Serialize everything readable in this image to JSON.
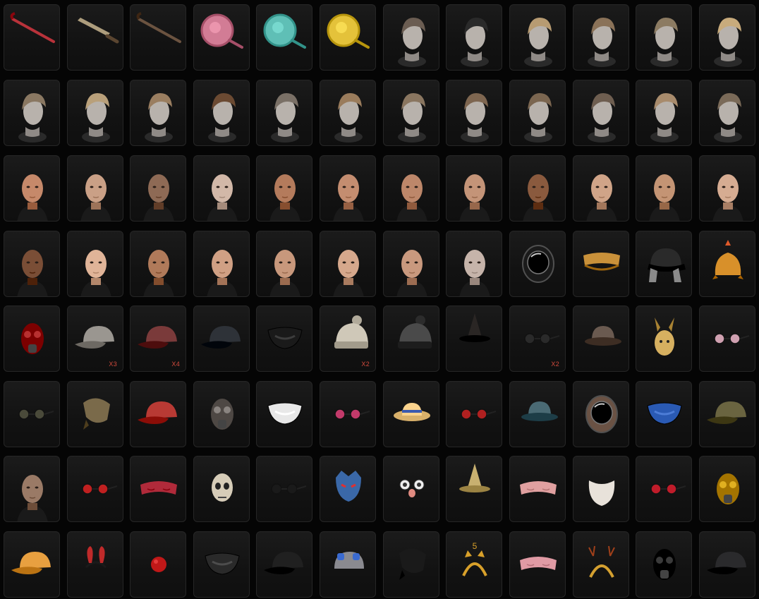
{
  "inventory": {
    "rows": [
      {
        "items": [
          {
            "name": "striped-crowbar-icon",
            "type": "crowbar",
            "color": "#b8323a"
          },
          {
            "name": "machete-icon",
            "type": "machete",
            "color": "#8a7a5a"
          },
          {
            "name": "crowbar-icon",
            "type": "crowbar",
            "color": "#6b5340"
          },
          {
            "name": "pink-frying-pan-icon",
            "type": "pan",
            "color": "#d27c95"
          },
          {
            "name": "graffiti-frying-pan-icon",
            "type": "pan",
            "color": "#5fbfb6"
          },
          {
            "name": "lollipop-frying-pan-icon",
            "type": "pan",
            "color": "#e4c23a"
          },
          {
            "name": "undercut-hair-icon",
            "type": "hair",
            "color": "#6b5d52"
          },
          {
            "name": "black-long-hair-icon",
            "type": "hair",
            "color": "#2a2a2a"
          },
          {
            "name": "blonde-bun-hair-icon",
            "type": "hair",
            "color": "#b79b72"
          },
          {
            "name": "tied-hair-icon",
            "type": "hair",
            "color": "#8a7258"
          },
          {
            "name": "dreadlocks-hair-icon",
            "type": "hair",
            "color": "#8c7b62"
          },
          {
            "name": "blonde-bob-hair-icon",
            "type": "hair",
            "color": "#c8ab7c"
          }
        ]
      },
      {
        "items": [
          {
            "name": "curly-short-hair-icon",
            "type": "hair",
            "color": "#8a7862"
          },
          {
            "name": "blonde-long-hair-icon",
            "type": "hair",
            "color": "#b9a07a"
          },
          {
            "name": "wavy-hair-icon",
            "type": "hair",
            "color": "#9a7e60"
          },
          {
            "name": "braided-hair-icon",
            "type": "hair",
            "color": "#6b4a32"
          },
          {
            "name": "bowl-cut-hair-icon",
            "type": "hair",
            "color": "#7a7066"
          },
          {
            "name": "side-braid-hair-icon",
            "type": "hair",
            "color": "#9a7c5c"
          },
          {
            "name": "messy-bob-hair-icon",
            "type": "hair",
            "color": "#8a7660"
          },
          {
            "name": "braid-hair-icon",
            "type": "hair",
            "color": "#7e6650"
          },
          {
            "name": "short-brown-hair-icon",
            "type": "hair",
            "color": "#7b6650"
          },
          {
            "name": "slick-hair-icon",
            "type": "hair",
            "color": "#6e5e50"
          },
          {
            "name": "short-bob-hair-icon",
            "type": "hair",
            "color": "#a88b6c"
          },
          {
            "name": "mushroom-hair-icon",
            "type": "hair",
            "color": "#7a6a58"
          }
        ]
      },
      {
        "items": [
          {
            "name": "female-face-icon",
            "type": "face",
            "color": "#c6896a"
          },
          {
            "name": "male-face-icon",
            "type": "face",
            "color": "#caa086"
          },
          {
            "name": "scarred-male-face-icon",
            "type": "face",
            "color": "#8e6a55"
          },
          {
            "name": "painted-face-icon",
            "type": "face",
            "color": "#d2b8a8"
          },
          {
            "name": "tattooed-face-icon",
            "type": "face",
            "color": "#b47b5c"
          },
          {
            "name": "female-face-icon",
            "type": "face",
            "color": "#c48d70"
          },
          {
            "name": "female-face-icon",
            "type": "face",
            "color": "#bd876a"
          },
          {
            "name": "makeup-face-icon",
            "type": "face",
            "color": "#c49478"
          },
          {
            "name": "dark-male-face-icon",
            "type": "face",
            "color": "#8a5a3e"
          },
          {
            "name": "male-face-icon",
            "type": "face",
            "color": "#d0a488"
          },
          {
            "name": "male-face-icon",
            "type": "face",
            "color": "#c49474"
          },
          {
            "name": "male-face-icon",
            "type": "face",
            "color": "#d6ac92"
          }
        ]
      },
      {
        "items": [
          {
            "name": "dark-male-face-icon",
            "type": "face",
            "color": "#7a4e36"
          },
          {
            "name": "pale-female-face-icon",
            "type": "face",
            "color": "#e0b498"
          },
          {
            "name": "female-face-icon",
            "type": "face",
            "color": "#b07a5a"
          },
          {
            "name": "female-face-icon",
            "type": "face",
            "color": "#d0a084"
          },
          {
            "name": "female-face-icon",
            "type": "face",
            "color": "#c8987c"
          },
          {
            "name": "female-face-icon",
            "type": "face",
            "color": "#d6a88c"
          },
          {
            "name": "female-face-icon",
            "type": "face",
            "color": "#c9997e"
          },
          {
            "name": "painted-face-icon",
            "type": "face",
            "color": "#c6b4aa"
          },
          {
            "name": "space-helmet-icon",
            "type": "helmet",
            "color": "#1a1a1a"
          },
          {
            "name": "gold-crown-band-icon",
            "type": "band",
            "color": "#c9913a"
          },
          {
            "name": "trapper-hat-icon",
            "type": "hat",
            "color": "#2a2a2a"
          },
          {
            "name": "chicken-hat-icon",
            "type": "chicken",
            "color": "#d8902a"
          }
        ]
      },
      {
        "items": [
          {
            "name": "gas-mask-icon",
            "type": "gasmask",
            "color": "#b83030"
          },
          {
            "name": "white-cap-icon",
            "type": "cap",
            "color": "#9a9690",
            "qty": "X3"
          },
          {
            "name": "red-cap-icon",
            "type": "cap",
            "color": "#7a3a3a",
            "qty": "X4"
          },
          {
            "name": "black-cap-icon",
            "type": "cap",
            "color": "#2e3238"
          },
          {
            "name": "monster-mask-icon",
            "type": "mask",
            "color": "#1a1a1a"
          },
          {
            "name": "beanie-icon",
            "type": "beanie",
            "color": "#cfc8b8",
            "qty": "X2"
          },
          {
            "name": "knit-beanie-icon",
            "type": "beanie",
            "color": "#4a4a4a"
          },
          {
            "name": "witch-hat-icon",
            "type": "witch",
            "color": "#2a2624"
          },
          {
            "name": "round-glasses-icon",
            "type": "glasses",
            "color": "#2a2a2a",
            "qty": "X2"
          },
          {
            "name": "bucket-hat-icon",
            "type": "bucket",
            "color": "#6a5a50"
          },
          {
            "name": "animal-mask-icon",
            "type": "animal",
            "color": "#d6b060"
          },
          {
            "name": "heart-glasses-icon",
            "type": "glasses",
            "color": "#cfa0b0"
          }
        ]
      },
      {
        "items": [
          {
            "name": "aviator-glasses-icon",
            "type": "glasses",
            "color": "#4a4a3a"
          },
          {
            "name": "camo-bandana-icon",
            "type": "bandana",
            "color": "#7a6a4a"
          },
          {
            "name": "red-black-cap-icon",
            "type": "cap",
            "color": "#b83a34"
          },
          {
            "name": "military-mask-icon",
            "type": "gasmask",
            "color": "#8a8480"
          },
          {
            "name": "zebra-mask-icon",
            "type": "mask",
            "color": "#e8e8e8"
          },
          {
            "name": "sport-glasses-icon",
            "type": "glasses",
            "color": "#c23a6a"
          },
          {
            "name": "straw-hat-icon",
            "type": "straw",
            "color": "#d8b06a"
          },
          {
            "name": "red-round-glasses-icon",
            "type": "glasses",
            "color": "#b02020"
          },
          {
            "name": "teal-bucket-hat-icon",
            "type": "bucket",
            "color": "#4a6a74"
          },
          {
            "name": "pilot-helmet-icon",
            "type": "helmet",
            "color": "#6a5244"
          },
          {
            "name": "blue-face-mask-icon",
            "type": "mask",
            "color": "#2a5ab4"
          },
          {
            "name": "headset-cap-icon",
            "type": "cap",
            "color": "#6a6440"
          }
        ]
      },
      {
        "items": [
          {
            "name": "stocking-mask-icon",
            "type": "face",
            "color": "#9a7a66"
          },
          {
            "name": "red-glasses-icon",
            "type": "glasses",
            "color": "#c02020"
          },
          {
            "name": "red-mask-icon",
            "type": "eyemask",
            "color": "#b02a3a"
          },
          {
            "name": "skull-mask-icon",
            "type": "skull",
            "color": "#d6ccb8"
          },
          {
            "name": "black-glasses-icon",
            "type": "glasses",
            "color": "#1a1a1a"
          },
          {
            "name": "demon-mask-icon",
            "type": "demon",
            "color": "#3a68a8"
          },
          {
            "name": "funny-glasses-icon",
            "type": "funny",
            "color": "#e0d0c0"
          },
          {
            "name": "gnome-hat-icon",
            "type": "witch",
            "color": "#c8b070"
          },
          {
            "name": "sleep-mask-icon",
            "type": "eyemask",
            "color": "#e0a0a0"
          },
          {
            "name": "santa-beard-icon",
            "type": "beard",
            "color": "#e8e2da"
          },
          {
            "name": "red-heart-glasses-icon",
            "type": "glasses",
            "color": "#c01c2a"
          },
          {
            "name": "yellow-gas-mask-icon",
            "type": "gasmask",
            "color": "#e0b020"
          }
        ]
      },
      {
        "items": [
          {
            "name": "orange-white-cap-icon",
            "type": "cap",
            "color": "#e8a040"
          },
          {
            "name": "bunny-ears-icon",
            "type": "ears",
            "color": "#c02a2a"
          },
          {
            "name": "red-nose-icon",
            "type": "nose",
            "color": "#c01818"
          },
          {
            "name": "black-face-mask-icon",
            "type": "mask",
            "color": "#2a2a2a"
          },
          {
            "name": "black-red-cap-icon",
            "type": "cap",
            "color": "#202020"
          },
          {
            "name": "goggles-helmet-icon",
            "type": "goggles",
            "color": "#8a8a90"
          },
          {
            "name": "black-bandana-icon",
            "type": "bandana",
            "color": "#1a1a1a"
          },
          {
            "name": "cat-ears-headband-icon",
            "type": "catband",
            "color": "#d8a02a"
          },
          {
            "name": "pink-sleep-mask-icon",
            "type": "eyemask",
            "color": "#e09aa4"
          },
          {
            "name": "reindeer-headband-icon",
            "type": "reindeer",
            "color": "#d4a030"
          },
          {
            "name": "tactical-mask-icon",
            "type": "gasmask",
            "color": "#3a3a3a"
          },
          {
            "name": "dark-cap-icon",
            "type": "cap",
            "color": "#2a2a2c"
          }
        ]
      }
    ]
  }
}
